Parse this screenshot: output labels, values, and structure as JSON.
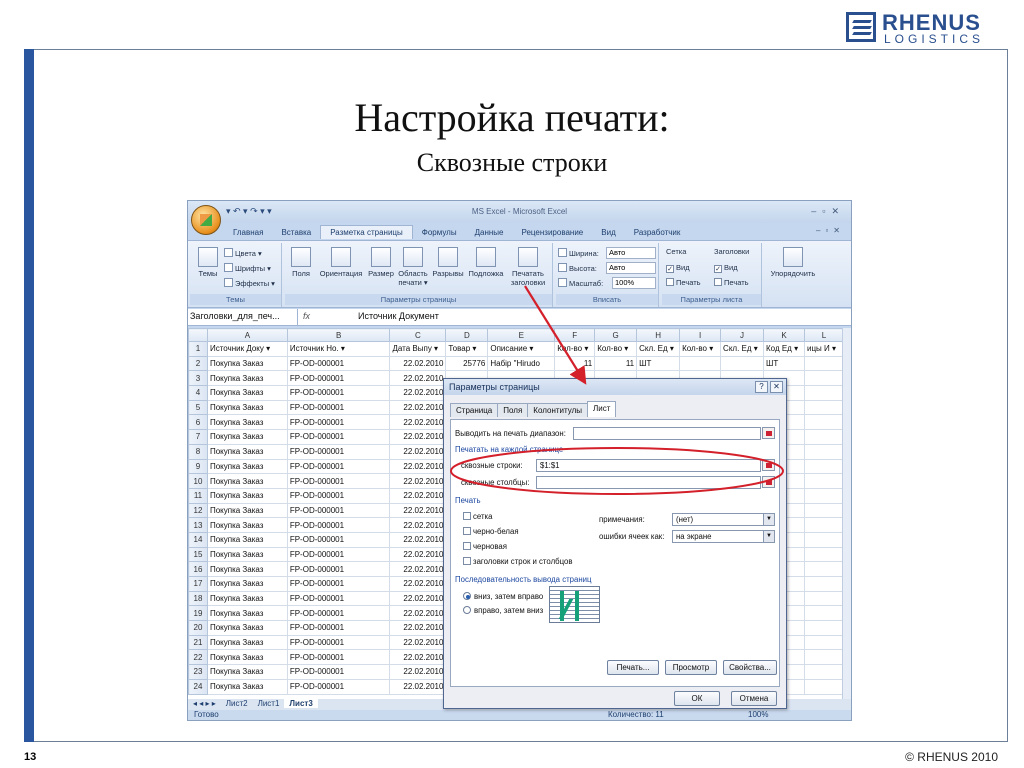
{
  "slide": {
    "title": "Настройка печати:",
    "subtitle": "Сквозные строки",
    "page_number": "13",
    "copyright": "© RHENUS 2010",
    "logo_line1": "RHENUS",
    "logo_line2": "LOGISTICS",
    "accent_color": "#2a4f8f"
  },
  "excel": {
    "window_title": "MS Excel - Microsoft Excel",
    "quick_access": "▾ ↶ ▾ ↷ ▾ ▾",
    "tabs": [
      "Главная",
      "Вставка",
      "Разметка страницы",
      "Формулы",
      "Данные",
      "Рецензирование",
      "Вид",
      "Разработчик"
    ],
    "active_tab": "Разметка страницы",
    "ribbon": {
      "themes_label": "Темы",
      "themes_group": "Темы",
      "colors": "Цвета ▾",
      "fonts": "Шрифты ▾",
      "effects": "Эффекты ▾",
      "margins": "Поля",
      "orientation": "Ориентация",
      "size": "Размер",
      "print_area": "Область печати ▾",
      "breaks": "Разрывы",
      "background": "Подложка",
      "print_titles": "Печатать заголовки",
      "page_setup_group": "Параметры страницы",
      "width_label": "Ширина:",
      "width_value": "Авто",
      "height_label": "Высота:",
      "height_value": "Авто",
      "scale_label": "Масштаб:",
      "scale_value": "100%",
      "fit_group": "Вписать",
      "gridlines_header": "Сетка",
      "headings_header": "Заголовки",
      "view_label": "Вид",
      "print_label": "Печать",
      "sheet_options_group": "Параметры листа",
      "arrange": "Упорядочить"
    },
    "name_box": "Заголовки_для_печ...",
    "formula_fx": "fx",
    "formula_value": "Источник Документ",
    "columns": [
      "A",
      "B",
      "C",
      "D",
      "E",
      "F",
      "G",
      "H",
      "I",
      "J",
      "K",
      "L"
    ],
    "header_row": [
      "Источник Доку",
      "Источник Но.",
      "Дата Выпу",
      "Товар",
      "Описание",
      "Кол-во",
      "Кол-во",
      "Скл. Ед",
      "Кол-во",
      "Скл. Ед",
      "Код Ед",
      "ицы И"
    ],
    "rows": [
      [
        "2",
        "Покупка Заказ",
        "FP-OD-000001",
        "22.02.2010",
        "25776",
        "Набір \"Hirudo",
        "11",
        "11",
        "ШТ",
        "",
        "",
        "ШТ"
      ],
      [
        "3",
        "Покупка Заказ",
        "FP-OD-000001",
        "22.02.2010"
      ],
      [
        "4",
        "Покупка Заказ",
        "FP-OD-000001",
        "22.02.2010"
      ],
      [
        "5",
        "Покупка Заказ",
        "FP-OD-000001",
        "22.02.2010"
      ],
      [
        "6",
        "Покупка Заказ",
        "FP-OD-000001",
        "22.02.2010"
      ],
      [
        "7",
        "Покупка Заказ",
        "FP-OD-000001",
        "22.02.2010"
      ],
      [
        "8",
        "Покупка Заказ",
        "FP-OD-000001",
        "22.02.2010"
      ],
      [
        "9",
        "Покупка Заказ",
        "FP-OD-000001",
        "22.02.2010"
      ],
      [
        "10",
        "Покупка Заказ",
        "FP-OD-000001",
        "22.02.2010"
      ],
      [
        "11",
        "Покупка Заказ",
        "FP-OD-000001",
        "22.02.2010"
      ],
      [
        "12",
        "Покупка Заказ",
        "FP-OD-000001",
        "22.02.2010"
      ],
      [
        "13",
        "Покупка Заказ",
        "FP-OD-000001",
        "22.02.2010"
      ],
      [
        "14",
        "Покупка Заказ",
        "FP-OD-000001",
        "22.02.2010"
      ],
      [
        "15",
        "Покупка Заказ",
        "FP-OD-000001",
        "22.02.2010"
      ],
      [
        "16",
        "Покупка Заказ",
        "FP-OD-000001",
        "22.02.2010"
      ],
      [
        "17",
        "Покупка Заказ",
        "FP-OD-000001",
        "22.02.2010"
      ],
      [
        "18",
        "Покупка Заказ",
        "FP-OD-000001",
        "22.02.2010"
      ],
      [
        "19",
        "Покупка Заказ",
        "FP-OD-000001",
        "22.02.2010"
      ],
      [
        "20",
        "Покупка Заказ",
        "FP-OD-000001",
        "22.02.2010"
      ],
      [
        "21",
        "Покупка Заказ",
        "FP-OD-000001",
        "22.02.2010"
      ],
      [
        "22",
        "Покупка Заказ",
        "FP-OD-000001",
        "22.02.2010"
      ],
      [
        "23",
        "Покупка Заказ",
        "FP-OD-000001",
        "22.02.2010"
      ],
      [
        "24",
        "Покупка Заказ",
        "FP-OD-000001",
        "22.02.2010"
      ]
    ],
    "sheet_tabs": [
      "Лист2",
      "Лист1",
      "Лист3"
    ],
    "active_sheet": "Лист3",
    "sheet_nav": "◂ ◂ ▸ ▸",
    "status_ready": "Готово",
    "status_count": "Количество: 11",
    "status_zoom": "100%"
  },
  "dialog": {
    "title": "Параметры страницы",
    "help": "?",
    "close": "✕",
    "tabs": [
      "Страница",
      "Поля",
      "Колонтитулы",
      "Лист"
    ],
    "active_tab": "Лист",
    "print_area_label": "Выводить на печать диапазон:",
    "print_area_value": "",
    "print_titles_section": "Печатать на каждой странице",
    "rows_label": "сквозные строки:",
    "rows_value": "$1:$1",
    "cols_label": "сквозные столбцы:",
    "cols_value": "",
    "print_section": "Печать",
    "gridlines": "сетка",
    "black_white": "черно-белая",
    "draft": "черновая",
    "headings": "заголовки строк и столбцов",
    "comments_label": "примечания:",
    "comments_value": "(нет)",
    "errors_label": "ошибки ячеек как:",
    "errors_value": "на экране",
    "order_section": "Последовательность вывода страниц",
    "down_then_over": "вниз, затем вправо",
    "over_then_down": "вправо, затем вниз",
    "print_button": "Печать...",
    "preview_button": "Просмотр",
    "options_button": "Свойства...",
    "ok_button": "ОК",
    "cancel_button": "Отмена",
    "highlight_color": "#d4202a"
  }
}
